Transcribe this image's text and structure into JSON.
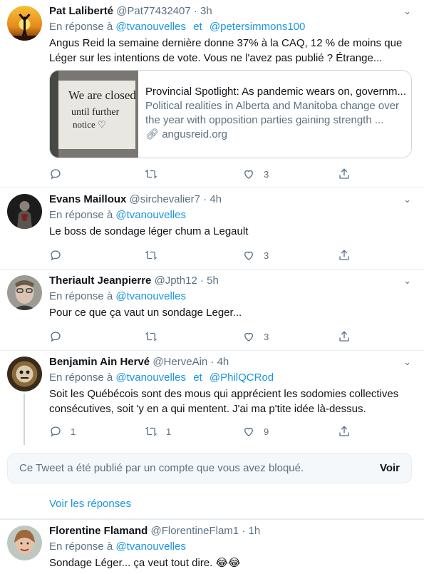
{
  "tweets": [
    {
      "name": "Pat Laliberté",
      "handle": "@Pat77432407",
      "time": "3h",
      "reply_prefix": "En réponse à",
      "reply_to": [
        "@tvanouvelles",
        "@petersimmons100"
      ],
      "reply_joiner": "et",
      "text": "Angus Reid la semaine dernière donne 37% à la CAQ, 12 % de moins que Léger sur les intentions de vote.  Vous ne l'avez pas publié ?  Étrange...",
      "card": {
        "image_text": [
          "We are closed",
          "until further",
          "notice ♡"
        ],
        "title": "Provincial Spotlight: As pandemic wears on, governm...",
        "description": "Political realities in Alberta and Manitoba change over the year with opposition parties gaining strength ...",
        "domain": "angusreid.org"
      },
      "replies": "",
      "retweets": "",
      "likes": "3"
    },
    {
      "name": "Evans Mailloux",
      "handle": "@sirchevalier7",
      "time": "4h",
      "reply_prefix": "En réponse à",
      "reply_to": [
        "@tvanouvelles"
      ],
      "text": "Le boss de sondage léger chum a Legault",
      "replies": "",
      "retweets": "",
      "likes": "3"
    },
    {
      "name": "Theriault Jeanpierre",
      "handle": "@Jpth12",
      "time": "5h",
      "reply_prefix": "En réponse à",
      "reply_to": [
        "@tvanouvelles"
      ],
      "text": "Pour ce que ça vaut un sondage Leger...",
      "replies": "",
      "retweets": "",
      "likes": "3"
    },
    {
      "name": "Benjamin Ain Hervé",
      "handle": "@HerveAin",
      "time": "4h",
      "reply_prefix": "En réponse à",
      "reply_to": [
        "@tvanouvelles",
        "@PhilQCRod"
      ],
      "reply_joiner": "et",
      "text": "Soit les Québécois sont des mous qui apprécient les sodomies collectives consécutives, soit 'y en a qui mentent. J'ai ma p'tite idée là-dessus.",
      "replies": "1",
      "retweets": "1",
      "likes": "9"
    },
    {
      "name": "Florentine Flamand",
      "handle": "@FlorentineFlam1",
      "time": "1h",
      "reply_prefix": "En réponse à",
      "reply_to": [
        "@tvanouvelles"
      ],
      "text": "Sondage Léger... ça veut tout dire. 😂😂"
    }
  ],
  "blocked": {
    "text": "Ce Tweet a été publié par un compte que vous avez bloqué.",
    "button": "Voir"
  },
  "show_replies": "Voir les réponses",
  "colors": {
    "link": "#1b95e0",
    "secondary": "#5b7083",
    "border": "#e6ecf0"
  },
  "icons": [
    "reply-icon",
    "retweet-icon",
    "like-icon",
    "share-icon",
    "chevron-down-icon",
    "link-icon"
  ]
}
